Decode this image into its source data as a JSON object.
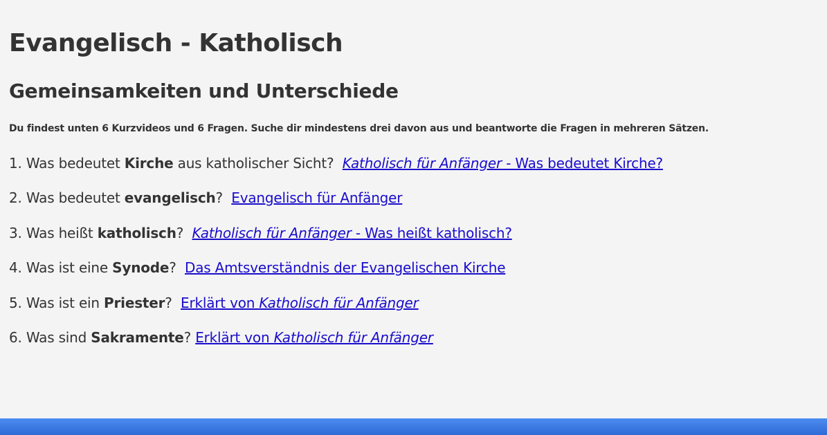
{
  "page": {
    "title": "Evangelisch - Katholisch",
    "subtitle": "Gemeinsamkeiten und Unterschiede",
    "intro": "Du findest unten 6 Kurzvideos und 6 Fragen. Suche dir mindestens drei davon aus und beantworte die Fragen in mehreren Sätzen."
  },
  "questions": [
    {
      "prefix": "1. Was bedeutet ",
      "keyword": "Kirche",
      "suffix": " aus katholischer Sicht?",
      "link_italic": "Katholisch für Anfänger",
      "link_rest": " - Was bedeutet Kirche?"
    },
    {
      "prefix": "2. Was bedeutet ",
      "keyword": "evangelisch",
      "suffix": "?",
      "link_text": "Evangelisch für Anfänger"
    },
    {
      "prefix": "3. Was heißt ",
      "keyword": "katholisch",
      "suffix": "?",
      "link_italic": "Katholisch für Anfänger",
      "link_rest": " - Was heißt katholisch?"
    },
    {
      "prefix": "4. Was ist eine ",
      "keyword": "Synode",
      "suffix": "?",
      "link_text": "Das Amtsverständnis der Evangelischen Kirche"
    },
    {
      "prefix": "5. Was ist ein ",
      "keyword": "Priester",
      "suffix": "?",
      "link_prefix": "Erklärt von ",
      "link_italic": "Katholisch für Anfänger"
    },
    {
      "prefix": "6. Was sind ",
      "keyword": "Sakramente",
      "suffix": "?",
      "link_prefix": "Erklärt von ",
      "link_italic": "Katholisch für Anfänger"
    }
  ],
  "colors": {
    "background": "#f4f4f4",
    "text": "#333333",
    "link": "#1a0dcc",
    "bottom_bar": "#3a78e6"
  }
}
